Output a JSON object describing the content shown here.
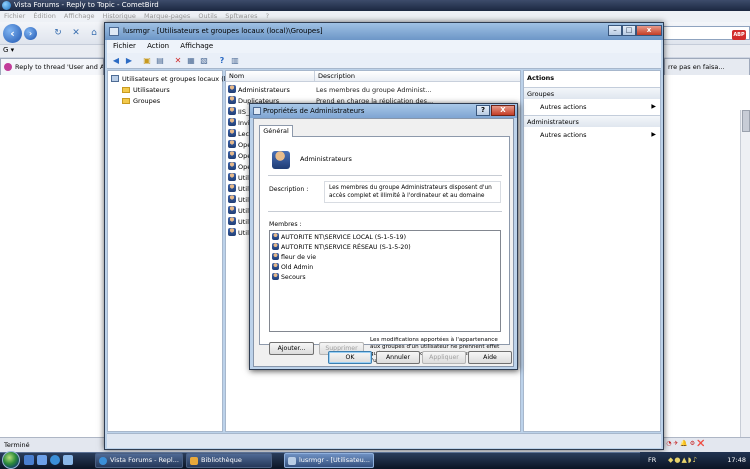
{
  "browser": {
    "title": "Vista Forums - Reply to Topic - CometBird",
    "menu": [
      "Fichier",
      "Édition",
      "Affichage",
      "Historique",
      "Marque-pages",
      "Outils",
      "Spftwares",
      "?"
    ],
    "active_tab": "Reply to thread 'User and A",
    "right_tab": "rre pas en faisa...",
    "search_label": "G ▾",
    "status": "Terminé",
    "status_right": "(e) ◔ ✈ 🔔 ⚙ ❌"
  },
  "mmc": {
    "title": "lusrmgr - [Utilisateurs et groupes locaux (local)\\Groupes]",
    "menu": [
      "Fichier",
      "Action",
      "Affichage"
    ],
    "tree": {
      "root": "Utilisateurs et groupes locaux (lc",
      "children": [
        "Utilisateurs",
        "Groupes"
      ]
    },
    "list": {
      "headers": [
        "Nom",
        "Description"
      ],
      "rows": [
        {
          "name": "Administrateurs",
          "desc": "Les membres du groupe Administ..."
        },
        {
          "name": "Duplicateurs",
          "desc": "Prend en charge la réplication des..."
        },
        {
          "name": "IIS_",
          "desc": ""
        },
        {
          "name": "Invi",
          "desc": ""
        },
        {
          "name": "Lec",
          "desc": ""
        },
        {
          "name": "Ope",
          "desc": ""
        },
        {
          "name": "Ope",
          "desc": ""
        },
        {
          "name": "Ope",
          "desc": ""
        },
        {
          "name": "Util",
          "desc": ""
        },
        {
          "name": "Util",
          "desc": ""
        },
        {
          "name": "Util",
          "desc": ""
        },
        {
          "name": "Util",
          "desc": ""
        },
        {
          "name": "Util",
          "desc": ""
        },
        {
          "name": "Util",
          "desc": ""
        }
      ]
    },
    "actions": {
      "header": "Actions",
      "sections": [
        {
          "title": "Groupes",
          "item": "Autres actions"
        },
        {
          "title": "Administrateurs",
          "item": "Autres actions"
        }
      ]
    }
  },
  "dialog": {
    "title": "Propriétés de Administrateurs",
    "help_glyph": "?",
    "close_glyph": "X",
    "tab": "Général",
    "group_name": "Administrateurs",
    "description_label": "Description :",
    "description": "Les membres du groupe Administrateurs disposent d'un accès complet et illimité à l'ordinateur et au domaine",
    "members_label": "Membres :",
    "members": [
      "AUTORITE NT\\SERVICE LOCAL (S-1-5-19)",
      "AUTORITE NT\\SERVICE RÉSEAU (S-1-5-20)",
      "fleur de vie",
      "Old Admin",
      "Secours"
    ],
    "add_label": "Ajouter...",
    "remove_label": "Supprimer",
    "note": "Les modifications apportées à l'appartenance aux groupes d'un utilisateur ne prennent effet qu'à la prochaine ouverture de session de l'utilisateur.",
    "ok_label": "OK",
    "cancel_label": "Annuler",
    "apply_label": "Appliquer",
    "help_label": "Aide"
  },
  "taskbar": {
    "buttons": [
      "Vista Forums - Repl...",
      "Bibliothèque",
      "lusrmgr - [Utilisateu..."
    ],
    "language": "FR",
    "clock": "17:48"
  }
}
